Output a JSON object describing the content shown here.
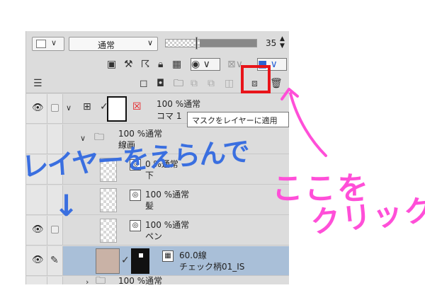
{
  "toolbar": {
    "blend_mode": "通常",
    "opacity": "35",
    "opacity_spin": "◇"
  },
  "tooltip": {
    "text": "マスクをレイヤーに適用"
  },
  "layers": [
    {
      "percent": "100 %通常",
      "name": "コマ 1"
    },
    {
      "percent": "100 %通常",
      "name": "線画"
    },
    {
      "percent": "0 %通常",
      "name": "下"
    },
    {
      "percent": "100 %通常",
      "name": "髪"
    },
    {
      "percent": "100 %通常",
      "name": "ペン"
    },
    {
      "percent": "60.0線",
      "name": "チェック柄01_IS"
    },
    {
      "percent": "100 %通常",
      "name": ""
    }
  ],
  "annotations": {
    "blue_text": "レイヤーをえらんで",
    "blue_arrow": "↓",
    "pink_line1": "ここを",
    "pink_line2": "クリック"
  },
  "colors": {
    "highlight_box": "#e8141a",
    "annotation_blue": "#3a6fe0",
    "annotation_pink": "#ff4fd8",
    "selected_row": "#a9bfd8"
  },
  "icons": {
    "eye": "eye-icon",
    "pen": "pen-icon",
    "folder": "folder-icon",
    "apply_mask": "apply-mask-icon"
  }
}
